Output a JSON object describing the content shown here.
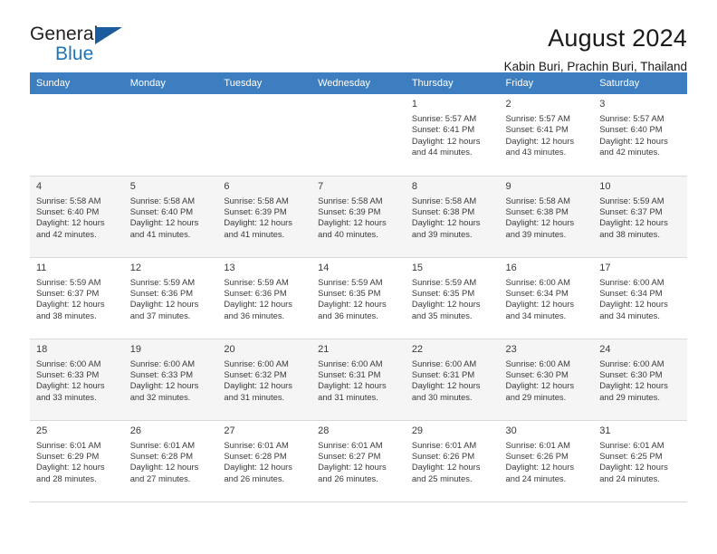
{
  "brand": {
    "name_top": "General",
    "name_bottom": "Blue",
    "triangle_color": "#1b5c9e",
    "blue_color": "#1b75bc"
  },
  "header": {
    "title": "August 2024",
    "subtitle": "Kabin Buri, Prachin Buri, Thailand"
  },
  "theme": {
    "header_row_bg": "#3c7ebf",
    "header_row_text": "#ffffff",
    "shaded_row_bg": "#f5f5f5",
    "plain_row_bg": "#ffffff",
    "grid_line": "#d9d9d9"
  },
  "weekdays": [
    "Sunday",
    "Monday",
    "Tuesday",
    "Wednesday",
    "Thursday",
    "Friday",
    "Saturday"
  ],
  "weeks": [
    {
      "shaded": false,
      "days": [
        {
          "num": "",
          "detail": ""
        },
        {
          "num": "",
          "detail": ""
        },
        {
          "num": "",
          "detail": ""
        },
        {
          "num": "",
          "detail": ""
        },
        {
          "num": "1",
          "detail": "Sunrise: 5:57 AM\nSunset: 6:41 PM\nDaylight: 12 hours\nand 44 minutes."
        },
        {
          "num": "2",
          "detail": "Sunrise: 5:57 AM\nSunset: 6:41 PM\nDaylight: 12 hours\nand 43 minutes."
        },
        {
          "num": "3",
          "detail": "Sunrise: 5:57 AM\nSunset: 6:40 PM\nDaylight: 12 hours\nand 42 minutes."
        }
      ]
    },
    {
      "shaded": true,
      "days": [
        {
          "num": "4",
          "detail": "Sunrise: 5:58 AM\nSunset: 6:40 PM\nDaylight: 12 hours\nand 42 minutes."
        },
        {
          "num": "5",
          "detail": "Sunrise: 5:58 AM\nSunset: 6:40 PM\nDaylight: 12 hours\nand 41 minutes."
        },
        {
          "num": "6",
          "detail": "Sunrise: 5:58 AM\nSunset: 6:39 PM\nDaylight: 12 hours\nand 41 minutes."
        },
        {
          "num": "7",
          "detail": "Sunrise: 5:58 AM\nSunset: 6:39 PM\nDaylight: 12 hours\nand 40 minutes."
        },
        {
          "num": "8",
          "detail": "Sunrise: 5:58 AM\nSunset: 6:38 PM\nDaylight: 12 hours\nand 39 minutes."
        },
        {
          "num": "9",
          "detail": "Sunrise: 5:58 AM\nSunset: 6:38 PM\nDaylight: 12 hours\nand 39 minutes."
        },
        {
          "num": "10",
          "detail": "Sunrise: 5:59 AM\nSunset: 6:37 PM\nDaylight: 12 hours\nand 38 minutes."
        }
      ]
    },
    {
      "shaded": false,
      "days": [
        {
          "num": "11",
          "detail": "Sunrise: 5:59 AM\nSunset: 6:37 PM\nDaylight: 12 hours\nand 38 minutes."
        },
        {
          "num": "12",
          "detail": "Sunrise: 5:59 AM\nSunset: 6:36 PM\nDaylight: 12 hours\nand 37 minutes."
        },
        {
          "num": "13",
          "detail": "Sunrise: 5:59 AM\nSunset: 6:36 PM\nDaylight: 12 hours\nand 36 minutes."
        },
        {
          "num": "14",
          "detail": "Sunrise: 5:59 AM\nSunset: 6:35 PM\nDaylight: 12 hours\nand 36 minutes."
        },
        {
          "num": "15",
          "detail": "Sunrise: 5:59 AM\nSunset: 6:35 PM\nDaylight: 12 hours\nand 35 minutes."
        },
        {
          "num": "16",
          "detail": "Sunrise: 6:00 AM\nSunset: 6:34 PM\nDaylight: 12 hours\nand 34 minutes."
        },
        {
          "num": "17",
          "detail": "Sunrise: 6:00 AM\nSunset: 6:34 PM\nDaylight: 12 hours\nand 34 minutes."
        }
      ]
    },
    {
      "shaded": true,
      "days": [
        {
          "num": "18",
          "detail": "Sunrise: 6:00 AM\nSunset: 6:33 PM\nDaylight: 12 hours\nand 33 minutes."
        },
        {
          "num": "19",
          "detail": "Sunrise: 6:00 AM\nSunset: 6:33 PM\nDaylight: 12 hours\nand 32 minutes."
        },
        {
          "num": "20",
          "detail": "Sunrise: 6:00 AM\nSunset: 6:32 PM\nDaylight: 12 hours\nand 31 minutes."
        },
        {
          "num": "21",
          "detail": "Sunrise: 6:00 AM\nSunset: 6:31 PM\nDaylight: 12 hours\nand 31 minutes."
        },
        {
          "num": "22",
          "detail": "Sunrise: 6:00 AM\nSunset: 6:31 PM\nDaylight: 12 hours\nand 30 minutes."
        },
        {
          "num": "23",
          "detail": "Sunrise: 6:00 AM\nSunset: 6:30 PM\nDaylight: 12 hours\nand 29 minutes."
        },
        {
          "num": "24",
          "detail": "Sunrise: 6:00 AM\nSunset: 6:30 PM\nDaylight: 12 hours\nand 29 minutes."
        }
      ]
    },
    {
      "shaded": false,
      "days": [
        {
          "num": "25",
          "detail": "Sunrise: 6:01 AM\nSunset: 6:29 PM\nDaylight: 12 hours\nand 28 minutes."
        },
        {
          "num": "26",
          "detail": "Sunrise: 6:01 AM\nSunset: 6:28 PM\nDaylight: 12 hours\nand 27 minutes."
        },
        {
          "num": "27",
          "detail": "Sunrise: 6:01 AM\nSunset: 6:28 PM\nDaylight: 12 hours\nand 26 minutes."
        },
        {
          "num": "28",
          "detail": "Sunrise: 6:01 AM\nSunset: 6:27 PM\nDaylight: 12 hours\nand 26 minutes."
        },
        {
          "num": "29",
          "detail": "Sunrise: 6:01 AM\nSunset: 6:26 PM\nDaylight: 12 hours\nand 25 minutes."
        },
        {
          "num": "30",
          "detail": "Sunrise: 6:01 AM\nSunset: 6:26 PM\nDaylight: 12 hours\nand 24 minutes."
        },
        {
          "num": "31",
          "detail": "Sunrise: 6:01 AM\nSunset: 6:25 PM\nDaylight: 12 hours\nand 24 minutes."
        }
      ]
    }
  ]
}
